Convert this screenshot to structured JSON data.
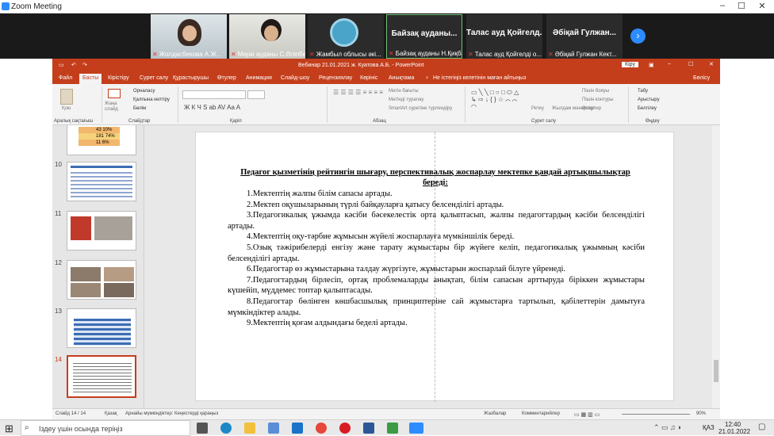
{
  "zoom": {
    "window_title": "Zoom Meeting",
    "participants": [
      {
        "name": "Жолдасбекова А.Ж...",
        "video": true
      },
      {
        "name": "Меркі ауданы С.Әліпбек...",
        "video": true
      },
      {
        "name": "Жамбыл облысы әкі...",
        "video": true
      },
      {
        "big": "Байзақ ауданы...",
        "name": "Байзақ ауданы Н.Қиқба..."
      },
      {
        "big": "Талас ауд Қойгелд...",
        "name": "Талас ауд Қойгелді о..."
      },
      {
        "big": "Әбіқай Гулжан...",
        "name": "Әбіқай Гулжан Кект..."
      }
    ]
  },
  "ppt": {
    "doc_title": "Вебинар 21.01.2021 ж. Куатова А.Б.  -  PowerPoint",
    "sign_in": "Кіру",
    "share": "Бөлісу",
    "tabs": [
      "Файл",
      "Басты",
      "Кірістіру",
      "Сурет салу",
      "Құрастырушы",
      "Өтулер",
      "Анимация",
      "Слайд-шоу",
      "Рецензиялау",
      "Көрініс",
      "Анықтама"
    ],
    "tell_me": "Не істегіңіз келетінін маған айтыңыз",
    "ribbon": {
      "groups": [
        "Аралық сақтағыш",
        "Слайдтар",
        "Қаріп",
        "Абзац",
        "Сурет салу",
        "Өңдеу"
      ],
      "paste": "Қою",
      "new_slide": "Жаңа слайд",
      "layout": "Орналасу",
      "reset": "Қалпына келтіру",
      "section": "Бөлім",
      "text_direction": "Мәтін бағыты",
      "align_text": "Мәтінді туралау",
      "smartart": "SmartArt суретіне түрлендіру",
      "arrange": "Ретеу",
      "quick_styles": "Жылдам мәнерлер",
      "fill": "Пішін бояуы",
      "outline": "Пішін контуры",
      "effects": "Әсерлер",
      "find": "Табу",
      "replace": "Ауыстыру",
      "select": "Белгілеу"
    },
    "thumbnails": [
      "10",
      "11",
      "12",
      "13",
      "14"
    ],
    "slide": {
      "title": "Педагог қызметінің рейтингін шығару, перспективалық жоспарлау мектепке қандай артықшылықтар береді:",
      "items": [
        "1.Мектептің жалпы білім сапасы артады.",
        "2.Мектеп оқушыларының түрлі байқауларға қатысу белсенділігі артады.",
        "3.Педагогикалық ұжымда кәсіби бәсекелестік орта қалыптасып, жалпы педагогтардың кәсіби белсенділігі артады.",
        "4.Мектептің оқу-тәрбие жұмысын жүйелі жоспарлауға мүмкіншілік береді.",
        "5.Озық тәжірибелерді енгізу және тарату жұмыстары бір жүйеге келіп, педагогикалық ұжымның кәсіби белсенділігі артады.",
        "6.Педагогтар өз жұмыстарына талдау жүргізуге, жұмыстарын жоспарлай білуге үйренеді.",
        "7.Педагогтардың бірлесіп, ортақ проблемаларды анықтап, білім сапасын арттыруда біріккен жұмыстары күшейіп, мүддемес топтар қалыптасады.",
        "8.Педагогтар бөлінген көшбасшылық принциптеріне сай жұмыстарға тартылып, қабілеттерін дамытуға мүмкіндіктер алады.",
        "9.Мектептің қоғам алдындағы беделі артады."
      ]
    },
    "status": {
      "slide": "Слайд 14 / 14",
      "lang": "Қазақ",
      "accessibility": "Арнайы мүмкіндіктер: Кеңестерді қараңыз",
      "notes": "Жазбалар",
      "comments": "Комментарийлер",
      "zoom": "90%"
    },
    "thumb_table": [
      "43",
      "10%",
      "181",
      "74%",
      "11",
      "6%"
    ]
  },
  "taskbar": {
    "search_placeholder": "Іздеу үшін осында теріңіз",
    "lang": "ҚАЗ",
    "time": "12:40",
    "date": "21.01.2022"
  },
  "colors": {
    "ppt_accent": "#c43e1c",
    "zoom_strip": "#1a1a1a"
  }
}
